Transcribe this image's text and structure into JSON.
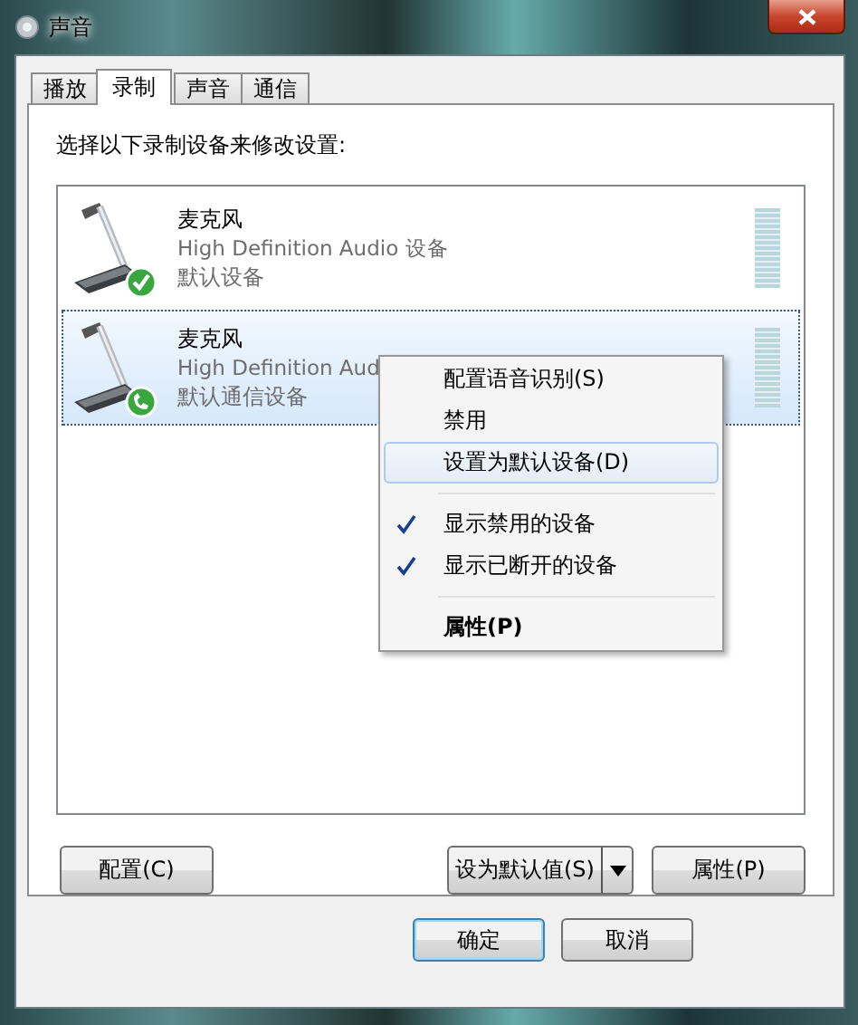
{
  "window": {
    "title": "声音"
  },
  "tabs": [
    {
      "label": "播放",
      "selected": false
    },
    {
      "label": "录制",
      "selected": true
    },
    {
      "label": "声音",
      "selected": false
    },
    {
      "label": "通信",
      "selected": false
    }
  ],
  "instruction": "选择以下录制设备来修改设置:",
  "devices": [
    {
      "name": "麦克风",
      "driver": "High Definition Audio 设备",
      "status": "默认设备",
      "kind": "check",
      "selected": false,
      "level": 0
    },
    {
      "name": "麦克风",
      "driver": "High Definition Aud",
      "status": "默认通信设备",
      "kind": "phone",
      "selected": true,
      "level": 0
    }
  ],
  "context_menu": [
    {
      "kind": "item",
      "label": "配置语音识别(S)",
      "selected": false,
      "checked": false,
      "bold": false
    },
    {
      "kind": "item",
      "label": "禁用",
      "selected": false,
      "checked": false,
      "bold": false
    },
    {
      "kind": "item",
      "label": "设置为默认设备(D)",
      "selected": true,
      "checked": false,
      "bold": false
    },
    {
      "kind": "separator"
    },
    {
      "kind": "item",
      "label": "显示禁用的设备",
      "selected": false,
      "checked": true,
      "bold": false
    },
    {
      "kind": "item",
      "label": "显示已断开的设备",
      "selected": false,
      "checked": true,
      "bold": false
    },
    {
      "kind": "separator"
    },
    {
      "kind": "item",
      "label": "属性(P)",
      "selected": false,
      "checked": false,
      "bold": true
    }
  ],
  "panel_buttons": {
    "configure": "配置(C)",
    "set_default": "设为默认值(S)",
    "properties": "属性(P)"
  },
  "dialog_buttons": [
    {
      "label": "确定",
      "default": true
    },
    {
      "label": "取消",
      "default": false
    }
  ]
}
